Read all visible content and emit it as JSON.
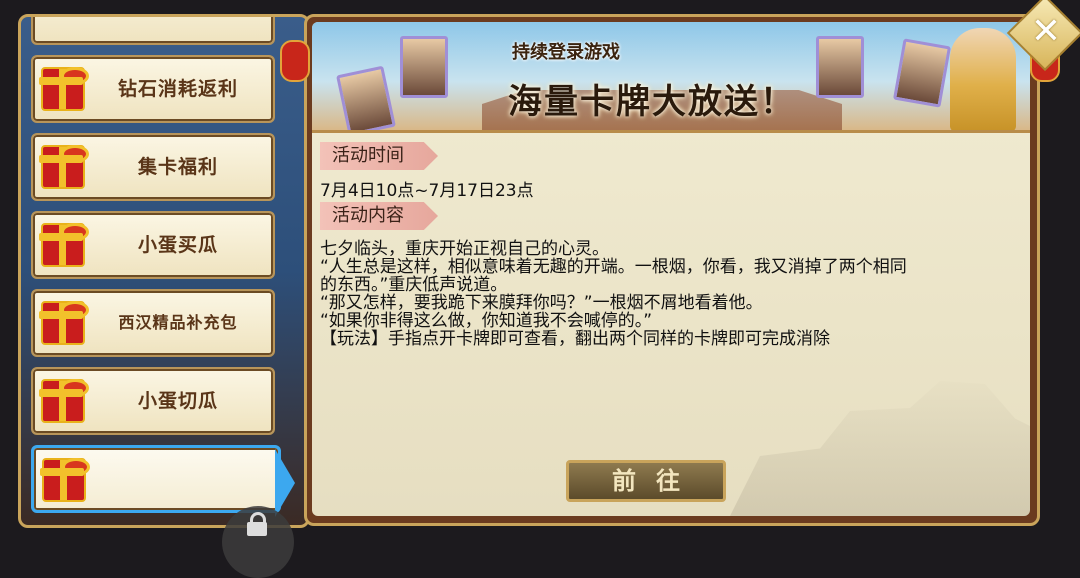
{
  "menu": {
    "items": [
      {
        "label": ""
      },
      {
        "label": "钻石消耗返利"
      },
      {
        "label": "集卡福利"
      },
      {
        "label": "小蛋买瓜"
      },
      {
        "label": "西汉精品补充包"
      },
      {
        "label": "小蛋切瓜"
      },
      {
        "label": ""
      }
    ],
    "active_index": 6
  },
  "banner": {
    "subtitle": "持续登录游戏",
    "title": "海量卡牌大放送！"
  },
  "activity": {
    "time_tag": "活动时间",
    "time_value": "7月4日10点~7月17日23点",
    "content_tag": "活动内容",
    "content_lines": [
      "七夕临头，重庆开始正视自己的心灵。",
      "“人生总是这样，相似意味着无趣的开端。一根烟，你看，我又消掉了两个相同",
      "的东西。”重庆低声说道。",
      "“那又怎样，要我跪下来膜拜你吗？”一根烟不屑地看着他。",
      "“如果你非得这么做，你知道我不会喊停的。”",
      "【玩法】手指点开卡牌即可查看，翻出两个同样的卡牌即可完成消除"
    ]
  },
  "buttons": {
    "go": "前往"
  },
  "colors": {
    "active_border": "#3ca8ef",
    "frame_gold": "#c9a45b",
    "tag_pink": "#e6a79c"
  },
  "icons": {
    "gift": "gift-box-icon",
    "close": "close-icon",
    "lock": "lock-icon"
  }
}
